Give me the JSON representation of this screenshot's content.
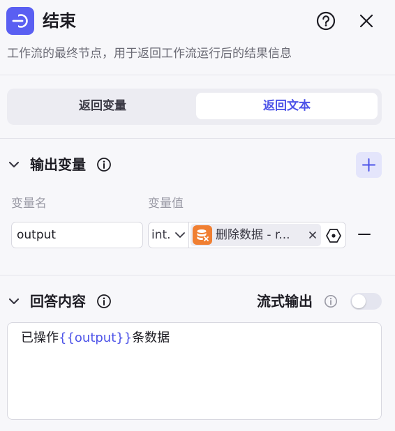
{
  "header": {
    "title": "结束",
    "description": "工作流的最终节点，用于返回工作流运行后的结果信息",
    "icons": {
      "node": "end-node-icon",
      "help": "help-icon",
      "close": "close-icon"
    }
  },
  "mode_tabs": {
    "options": [
      "返回变量",
      "返回文本"
    ],
    "selected": "返回文本"
  },
  "output_section": {
    "title": "输出变量",
    "columns": {
      "name": "变量名",
      "value": "变量值"
    },
    "variables": [
      {
        "name": "output",
        "type": "int.",
        "reference": "删除数据 - r..."
      }
    ]
  },
  "answer_section": {
    "title": "回答内容",
    "stream_label": "流式输出",
    "stream_enabled": false,
    "content": {
      "prefix": "已操作",
      "variable": "{{output}}",
      "suffix": "条数据"
    }
  },
  "colors": {
    "accent": "#4d53e8",
    "node_icon_bg": "#5a5ff2",
    "ref_icon_bg": "#f07f32",
    "panel_bg": "#f7f7fa"
  }
}
